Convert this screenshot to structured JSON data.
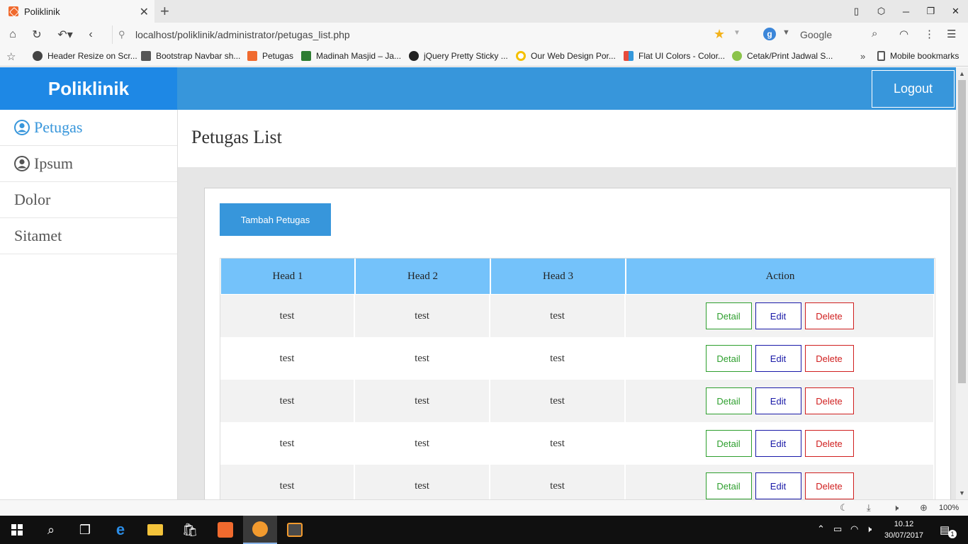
{
  "browser": {
    "tab_title": "Poliklinik",
    "close_glyph": "✕",
    "new_tab_glyph": "+",
    "url": "localhost/poliklinik/administrator/petugas_list.php",
    "search_placeholder": "Google",
    "search_engine_letter": "g",
    "bookmarks": [
      {
        "label": "Header Resize on Scr...",
        "color": "#444444"
      },
      {
        "label": "Bootstrap Navbar sh...",
        "color": "#555555"
      },
      {
        "label": "Petugas",
        "color": "#f06a2e"
      },
      {
        "label": "Madinah Masjid – Ja...",
        "color": "#2e7d32"
      },
      {
        "label": "jQuery Pretty Sticky ...",
        "color": "#222222"
      },
      {
        "label": "Our Web Design Por...",
        "color": "#f5c000"
      },
      {
        "label": "Flat UI Colors - Color...",
        "color": "#e74c3c"
      },
      {
        "label": "Cetak/Print Jadwal S...",
        "color": "#8bc34a"
      }
    ],
    "bookmarks_more": "»",
    "mobile_bookmarks": "Mobile bookmarks",
    "zoom": "100%"
  },
  "app": {
    "brand": "Poliklinik",
    "logout_label": "Logout",
    "sidebar": [
      {
        "label": "Petugas",
        "icon": "user-icon",
        "active": true
      },
      {
        "label": "Ipsum",
        "icon": "user-icon",
        "active": false
      },
      {
        "label": "Dolor",
        "active": false
      },
      {
        "label": "Sitamet",
        "active": false
      }
    ],
    "page_title": "Petugas List",
    "add_button": "Tambah Petugas",
    "table": {
      "headers": [
        "Head 1",
        "Head 2",
        "Head 3",
        "Action"
      ],
      "rows": [
        [
          "test",
          "test",
          "test"
        ],
        [
          "test",
          "test",
          "test"
        ],
        [
          "test",
          "test",
          "test"
        ],
        [
          "test",
          "test",
          "test"
        ],
        [
          "test",
          "test",
          "test"
        ]
      ],
      "actions": {
        "detail": "Detail",
        "edit": "Edit",
        "delete": "Delete"
      }
    }
  },
  "taskbar": {
    "time": "10.12",
    "date": "30/07/2017",
    "notification_count": "1"
  },
  "colors": {
    "brand_bg": "#1e88e5",
    "topbar_bg": "#3796db",
    "table_header_bg": "#74c2fa",
    "detail": "#2e9f2e",
    "edit": "#1a1aa8",
    "delete": "#d01f1f"
  }
}
